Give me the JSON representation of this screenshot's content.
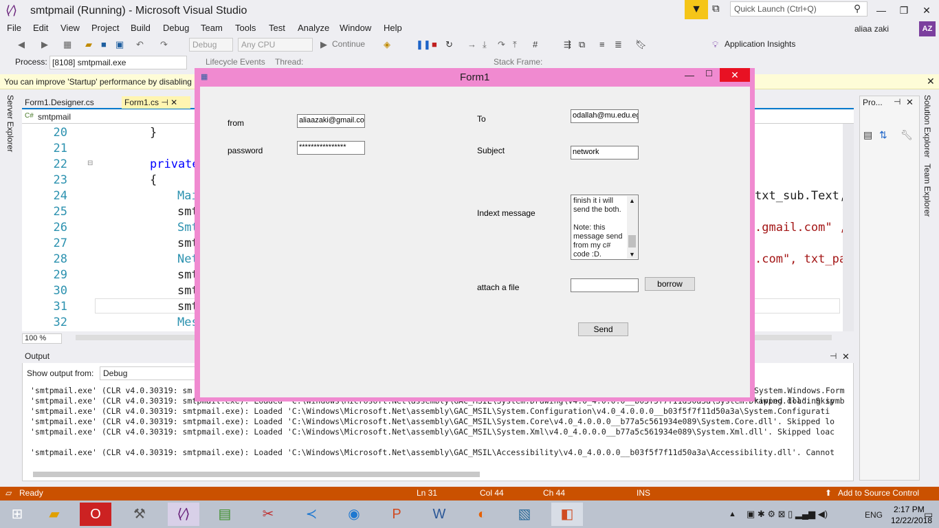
{
  "window": {
    "title": "smtpmail (Running) - Microsoft Visual Studio",
    "quick_launch_placeholder": "Quick Launch (Ctrl+Q)",
    "user": "aliaa zaki",
    "user_initials": "AZ"
  },
  "menu": [
    "File",
    "Edit",
    "View",
    "Project",
    "Build",
    "Debug",
    "Team",
    "Tools",
    "Test",
    "Analyze",
    "Window",
    "Help"
  ],
  "toolbar": {
    "config": "Debug",
    "platform": "Any CPU",
    "continue": "Continue",
    "lifecycle": "Lifecycle Events",
    "thread": "Thread:",
    "stack_frame": "Stack Frame:",
    "app_insights": "Application Insights"
  },
  "process": {
    "label": "Process:",
    "value": "[8108] smtpmail.exe"
  },
  "infobar": {
    "text": "You can improve 'Startup' performance by disabling"
  },
  "side": {
    "server_explorer": "Server Explorer",
    "solution_explorer": "Solution Explorer",
    "team_explorer": "Team Explorer"
  },
  "editor": {
    "tabs": [
      "Form1.Designer.cs",
      "Form1.cs"
    ],
    "nav": "smtpmail",
    "zoom": "100 %",
    "lines": [
      {
        "n": "20",
        "text": "}"
      },
      {
        "n": "21",
        "text": ""
      },
      {
        "n": "22",
        "text": "private"
      },
      {
        "n": "23",
        "text": "{"
      },
      {
        "n": "24",
        "text": "Mai"
      },
      {
        "n": "25",
        "text": "smt"
      },
      {
        "n": "26",
        "text": "Smt"
      },
      {
        "n": "27",
        "text": "smt"
      },
      {
        "n": "28",
        "text": "Net"
      },
      {
        "n": "29",
        "text": "smt"
      },
      {
        "n": "30",
        "text": "smt"
      },
      {
        "n": "31",
        "text": "smt"
      },
      {
        "n": "32",
        "text": "Mes"
      }
    ],
    "right_fragments": [
      "txt_sub.Text,",
      ".gmail.com\" ,",
      ".com\", txt_pa"
    ]
  },
  "properties": {
    "title": "Pro..."
  },
  "output": {
    "title": "Output",
    "show_from_label": "Show output from:",
    "show_from_value": "Debug",
    "lines": [
      "'smtpmail.exe' (CLR v4.0.30319: sm",
      "'smtpmail.exe' (CLR v4.0.30319: smtpmail.exe): Loaded 'C:\\Windows\\Microsoft.Net\\assembly\\GAC_MSIL\\System.Drawing\\v4.0_4.0.0.0__b03f5f7f11d50a3a\\System.Drawing.dll'. Skip",
      "'smtpmail.exe' (CLR v4.0.30319: smtpmail.exe): Loaded 'C:\\Windows\\Microsoft.Net\\assembly\\GAC_MSIL\\System.Configuration\\v4.0_4.0.0.0__b03f5f7f11d50a3a\\System.Configurati",
      "'smtpmail.exe' (CLR v4.0.30319: smtpmail.exe): Loaded 'C:\\Windows\\Microsoft.Net\\assembly\\GAC_MSIL\\System.Core\\v4.0_4.0.0.0__b77a5c561934e089\\System.Core.dll'. Skipped lo",
      "'smtpmail.exe' (CLR v4.0.30319: smtpmail.exe): Loaded 'C:\\Windows\\Microsoft.Net\\assembly\\GAC_MSIL\\System.Xml\\v4.0_4.0.0.0__b77a5c561934e089\\System.Xml.dll'. Skipped loac",
      "'smtpmail.exe' (CLR v4.0.30319: smtpmail.exe): Loaded 'C:\\Windows\\Microsoft.Net\\assembly\\GAC_MSIL\\Accessibility\\v4.0_4.0.0.0__b03f5f7f11d50a3a\\Accessibility.dll'. Cannot"
    ],
    "right_fragments": [
      "System.Windows.Form",
      "kipped loading symb"
    ]
  },
  "status": {
    "ready": "Ready",
    "ln": "Ln 31",
    "col": "Col 44",
    "ch": "Ch 44",
    "ins": "INS",
    "source_control": "Add to Source Control"
  },
  "form1": {
    "title": "Form1",
    "from_label": "from",
    "from_value": "aliaazaki@gmail.com",
    "password_label": "password",
    "password_value": "****************",
    "to_label": "To",
    "to_value": "odallah@mu.edu.eg",
    "subject_label": "Subject",
    "subject_value": "network",
    "message_label": "Indext message",
    "message_value": "finish it i will\nsend the both.\n\nNote: this\nmessage send\nfrom my c#\ncode :D.",
    "attach_label": "attach a file",
    "attach_value": "",
    "borrow_button": "borrow",
    "send_button": "Send"
  },
  "taskbar": {
    "lang": "ENG",
    "time": "2:17 PM",
    "date": "12/22/2018"
  }
}
